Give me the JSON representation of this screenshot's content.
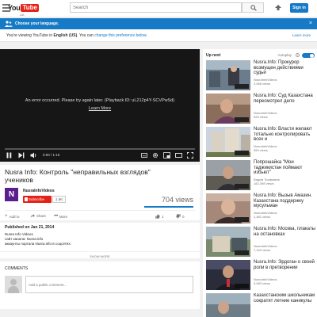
{
  "header": {
    "logo_you": "You",
    "logo_tube": "Tube",
    "region": "UA",
    "search_placeholder": "Search",
    "sign_in": "Sign in"
  },
  "language_bar": {
    "title": "Choose your language.",
    "message_prefix": "You're viewing YouTube in ",
    "language": "English (US)",
    "message_middle": ". You can ",
    "change_link": "change this preference below",
    "message_suffix": ".",
    "learn_more": "Learn more"
  },
  "player": {
    "error_text": "An error occurred. Please try again later. (Playback ID: uL212p4Y-SCVPwSd)",
    "error_link": "Learn More",
    "time": "0:00 / 1:19",
    "progress_fraction": 0.0
  },
  "video": {
    "title": "Nusra Info: Контроль \"неправильных взглядов\" учеников",
    "channel_initial": "N",
    "channel_name": "NusraInfoVideos",
    "subscribe_label": "Subscribe",
    "subscriber_count": "1.6K",
    "views": "704 views",
    "actions": {
      "add_to": "Add to",
      "share": "Share",
      "more": "More",
      "likes": "1",
      "dislikes": "0"
    }
  },
  "description": {
    "published": "Published on Jan 21, 2014",
    "lines": [
      "Nusra Info Videos",
      "сайт канала: Nusra.info",
      "аккаунты портала Nusra.info в соцсетях:"
    ],
    "show_more": "SHOW MORE"
  },
  "comments": {
    "header": "COMMENTS",
    "placeholder": "Add a public comment..."
  },
  "sidebar": {
    "up_next": "Up next",
    "autoplay": "Autoplay",
    "autoplay_info": "i",
    "autoplay_on": true,
    "items": [
      {
        "title": "Nusra.Info: Прокурор возмущен действиями судьи",
        "channel": "NusraInfoVideos",
        "views": "3,068 views"
      },
      {
        "title": "Nusra.Info: Суд Казахстана пересмотрел дело",
        "channel": "NusraInfoVideos",
        "views": "525 views"
      },
      {
        "title": "Nusra.Info: Власти желают тотально контролировать всех и",
        "channel": "NusraInfoVideos",
        "views": "559 views"
      },
      {
        "title": "Попрошайка \"Мои таджикистан поймают избьют\"",
        "channel": "Вадим Трофимов",
        "views": "182,398 views"
      },
      {
        "title": "Nusra.Info: Вызыв Амазин. Казахстана поддержку мусульман",
        "channel": "NusraInfoVideos",
        "views": "2,481 views"
      },
      {
        "title": "Nusra.Info: Москва, плакаты на остановках",
        "channel": "NusraInfoVideos",
        "views": "7,153 views"
      },
      {
        "title": "Nusra.Info: Эрдоган о своей роли в претворении",
        "channel": "NusraInfoVideos",
        "views": "3,083 views"
      },
      {
        "title": "Казахстанским школьникам сократят летние каникулы",
        "channel": "",
        "views": ""
      }
    ]
  },
  "colors": {
    "brand_red": "#e62117",
    "accent_blue": "#167ac6",
    "player_bg": "#161616"
  }
}
